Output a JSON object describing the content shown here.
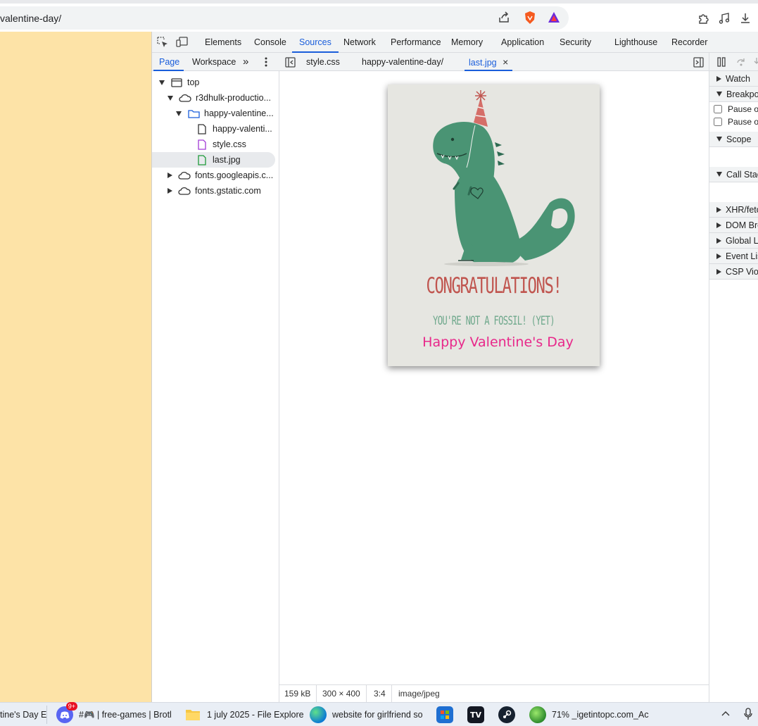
{
  "browser": {
    "url": "valentine-day/",
    "toolbar_icons": [
      "share-icon",
      "brave-shield-icon",
      "brave-rewards-icon",
      "extensions-icon",
      "media-icon",
      "downloads-icon"
    ]
  },
  "devtools": {
    "main_tabs": [
      "Elements",
      "Console",
      "Sources",
      "Network",
      "Performance",
      "Memory",
      "Application",
      "Security",
      "Lighthouse",
      "Recorder"
    ],
    "active_main_tab": "Sources",
    "navigator": {
      "tabs": [
        "Page",
        "Workspace"
      ],
      "more": "»",
      "tree": [
        {
          "label": "top",
          "kind": "frame",
          "expanded": true
        },
        {
          "label": "r3dhulk-productio...",
          "kind": "origin",
          "expanded": true
        },
        {
          "label": "happy-valentine...",
          "kind": "folder",
          "expanded": true
        },
        {
          "label": "happy-valenti...",
          "kind": "document"
        },
        {
          "label": "style.css",
          "kind": "stylesheet"
        },
        {
          "label": "last.jpg",
          "kind": "image",
          "selected": true
        },
        {
          "label": "fonts.googleapis.c...",
          "kind": "origin",
          "expanded": false
        },
        {
          "label": "fonts.gstatic.com",
          "kind": "origin",
          "expanded": false
        }
      ]
    },
    "editor": {
      "tabs": [
        "style.css",
        "happy-valentine-day/",
        "last.jpg"
      ],
      "active_tab": "last.jpg",
      "close_glyph": "×",
      "image": {
        "headline": "CONGRATULATIONS!",
        "subline": "YOU'RE NOT A FOSSIL! (YET)",
        "caption": "Happy Valentine's Day",
        "headline_color": "#c0554f",
        "subline_color": "#6fa88c",
        "caption_color": "#e8288a",
        "dino_color": "#4a9474",
        "card_bg": "#e6e6e1"
      },
      "status": {
        "size": "159 kB",
        "dimensions": "300 × 400",
        "ratio": "3:4",
        "mime": "image/jpeg"
      }
    },
    "debugger": {
      "sections": [
        {
          "label": "Watch",
          "expanded": false
        },
        {
          "label": "Breakpoints",
          "expanded": true
        },
        {
          "label": "Scope",
          "expanded": true
        },
        {
          "label": "Call Stack",
          "expanded": true
        },
        {
          "label": "XHR/fetch Breakpoints",
          "expanded": false
        },
        {
          "label": "DOM Breakpoints",
          "expanded": false
        },
        {
          "label": "Global Listeners",
          "expanded": false
        },
        {
          "label": "Event Listener Breakpoints",
          "expanded": false
        },
        {
          "label": "CSP Violation Breakpoints",
          "expanded": false
        }
      ],
      "checkboxes": [
        "Pause on uncaught exceptions",
        "Pause on caught exceptions"
      ]
    }
  },
  "taskbar": {
    "items": [
      {
        "label": "tine's Day E",
        "icon": "browser-tab-icon"
      },
      {
        "label": "#🎮 | free-games | Brotl",
        "icon": "discord-icon",
        "badge": "9+"
      },
      {
        "label": "1 july 2025 - File Explore",
        "icon": "folder-icon"
      },
      {
        "label": "website for girlfriend so",
        "icon": "edge-icon"
      },
      {
        "label": "",
        "icon": "store-icon"
      },
      {
        "label": "",
        "icon": "tradingview-icon"
      },
      {
        "label": "",
        "icon": "steam-icon"
      },
      {
        "label": "71% _igetintopc.com_Ac",
        "icon": "download-manager-icon"
      }
    ],
    "tray": [
      "chevron-up-icon",
      "microphone-icon"
    ]
  }
}
